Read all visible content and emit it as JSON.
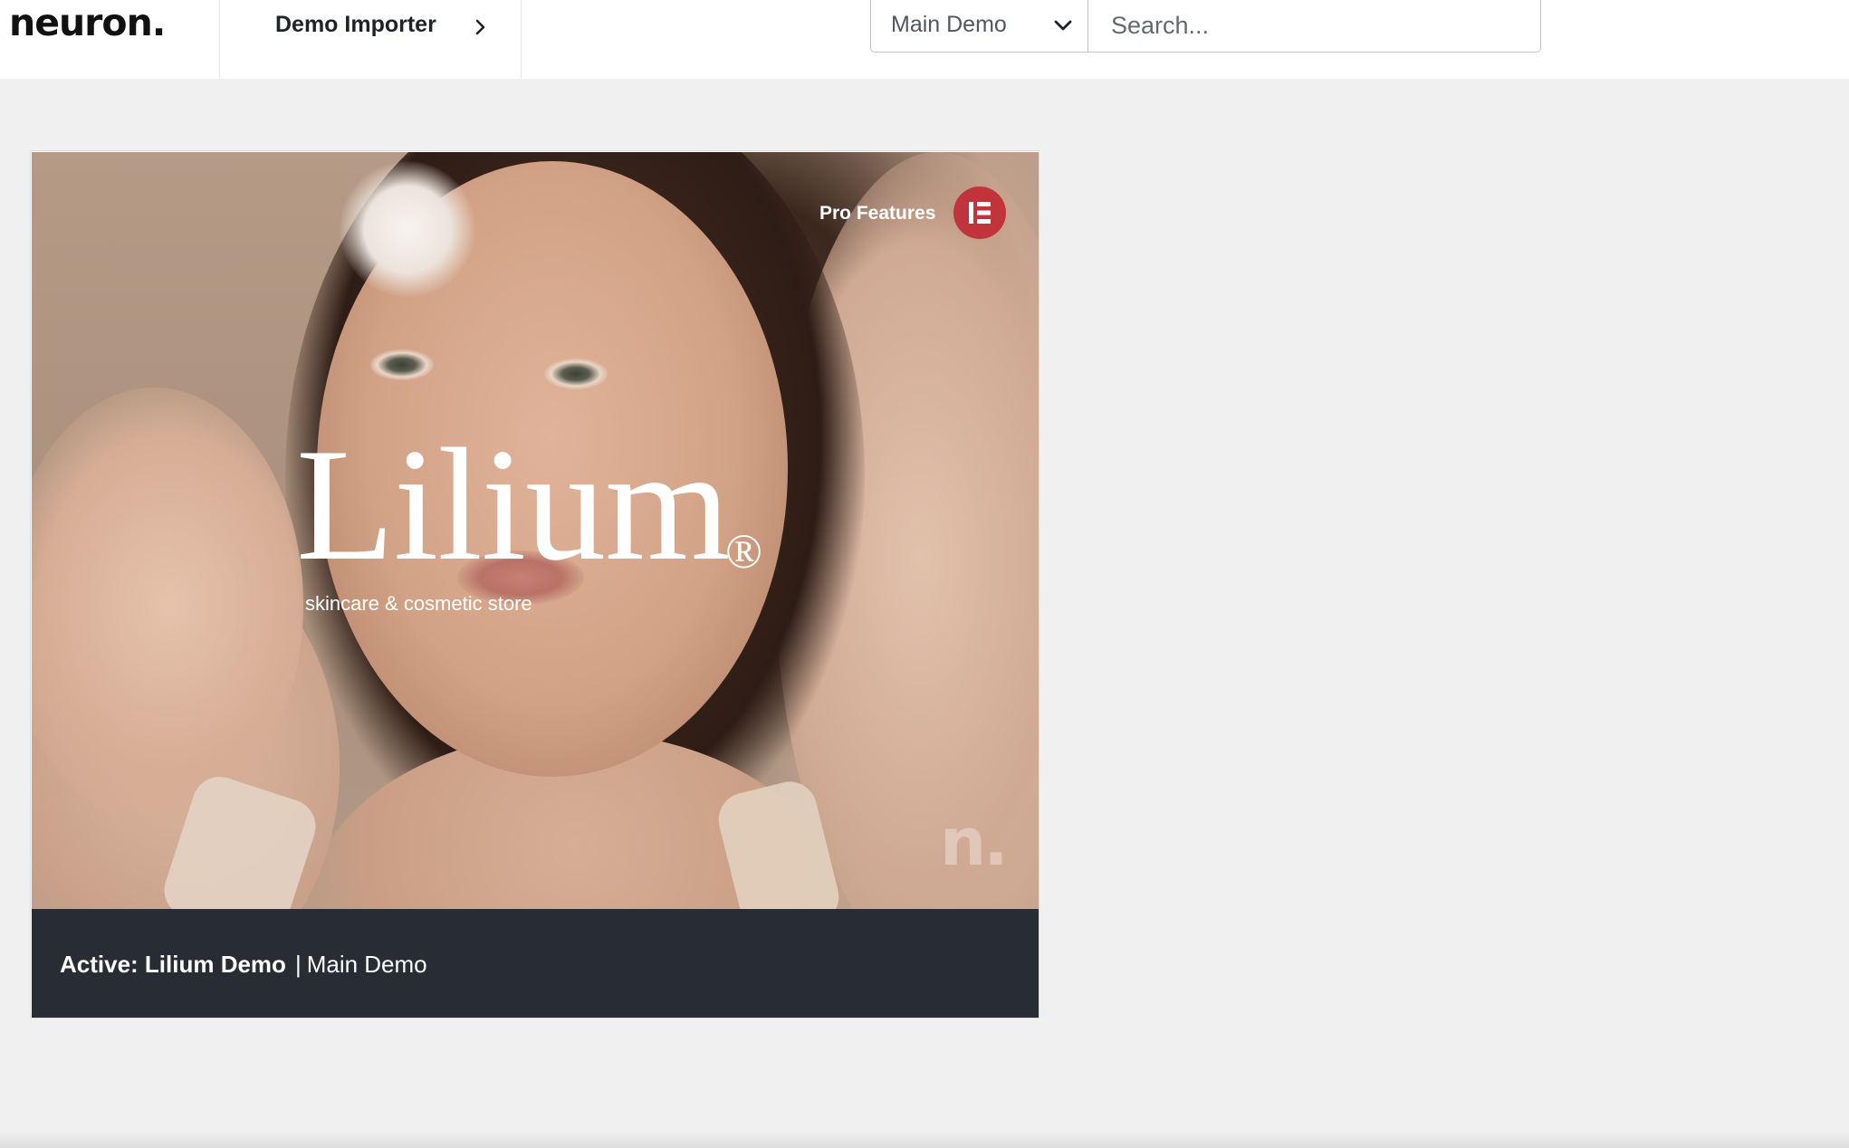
{
  "header": {
    "logo_text": "neuron.",
    "breadcrumb_label": "Demo Importer",
    "demo_select_value": "Main Demo",
    "search_placeholder": "Search..."
  },
  "card": {
    "brand_title": "Lilium",
    "brand_registered": "®",
    "brand_subtitle": "skincare & cosmetic store",
    "pro_features_label": "Pro Features",
    "watermark_text": "n.",
    "footer_active_label": "Active: Lilium Demo",
    "footer_separator": "|",
    "footer_demo_name": "Main Demo"
  },
  "colors": {
    "topbar_bg": "#ffffff",
    "page_bg": "#f0f0f1",
    "card_footer_bg": "#282c35",
    "elementor_red": "#c1343c"
  },
  "icons": {
    "breadcrumb": "chevron-right-icon",
    "select": "chevron-down-icon",
    "pro": "elementor-icon"
  }
}
